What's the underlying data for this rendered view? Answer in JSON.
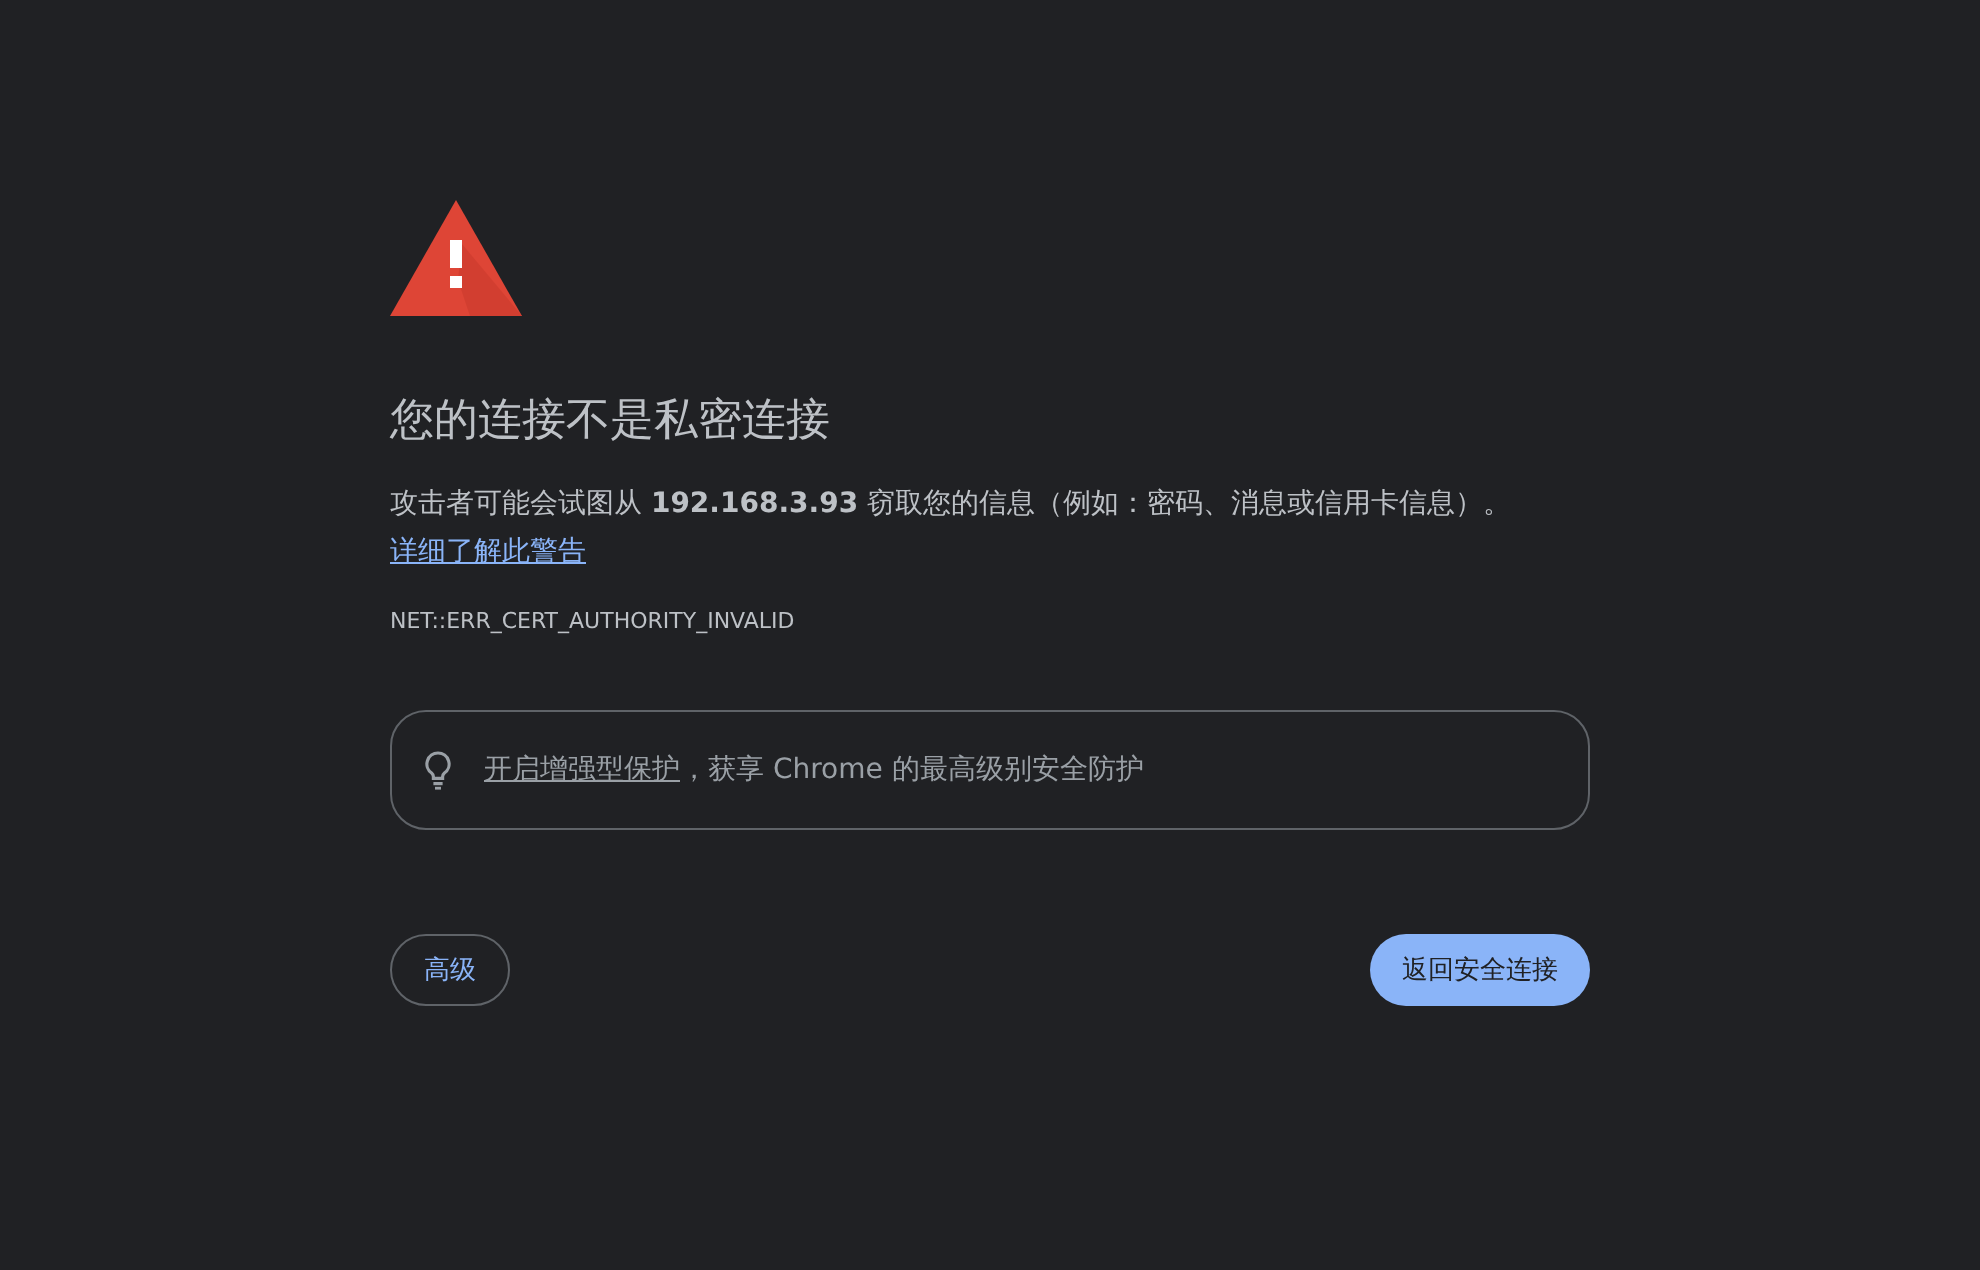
{
  "heading": "您的连接不是私密连接",
  "message": {
    "text": "攻击者可能会试图从 **192.168.3.93** 窃取您的信息（例如：密码、消息或信用卡信息）。",
    "link": "详细了解此警告"
  },
  "error_code": "NET::ERR_CERT_AUTHORITY_INVALID",
  "tip": {
    "link": "开启增强型保护",
    "text": "，获享 Chrome 的最高级别安全防护"
  },
  "buttons": [
    {
      "label": "高级",
      "kind": "secondary"
    },
    {
      "label": "返回安全连接",
      "kind": "primary"
    }
  ]
}
